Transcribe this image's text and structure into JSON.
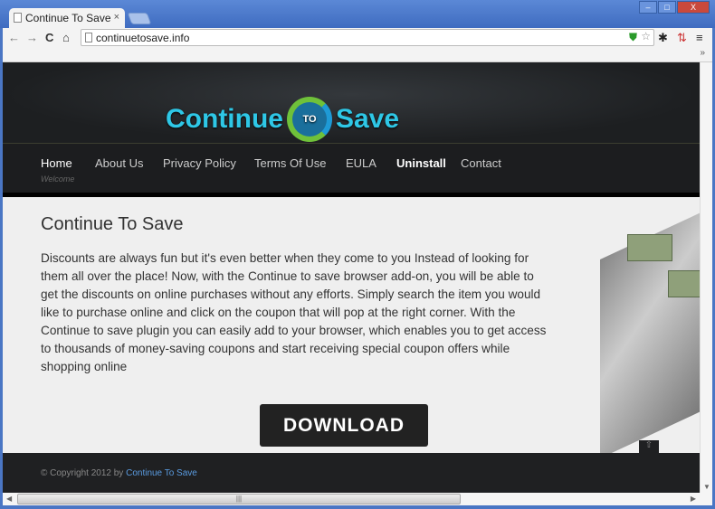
{
  "browser": {
    "tab_title": "Continue To Save",
    "url": "continuetosave.info",
    "win_buttons": [
      "–",
      "□",
      "X"
    ],
    "bookmarks_more": "»"
  },
  "site": {
    "logo": {
      "left": "Continue",
      "middle": "TO",
      "right": "Save"
    },
    "menu": [
      {
        "label": "Home"
      },
      {
        "label": "About Us"
      },
      {
        "label": "Privacy Policy"
      },
      {
        "label": "Terms Of Use"
      },
      {
        "label": "EULA"
      },
      {
        "label": "Uninstall"
      },
      {
        "label": "Contact"
      }
    ],
    "menu_sub": "Welcome",
    "heading": "Continue To Save",
    "paragraph": "Discounts are always fun but it's even better when they come to you Instead of looking for them all over the place! Now, with the Continue to save browser add-on, you will be able to get the discounts on online purchases without any efforts. Simply search the item you would like to purchase online and click on the coupon that will pop at the right corner. With the Continue to save plugin you can easily add to your browser, which enables you to get access to thousands of money-saving coupons and start receiving special coupon offers while shopping online",
    "download": "DOWNLOAD",
    "footer": {
      "copyright": "© Copyright 2012 by",
      "link": "Continue To Save"
    },
    "back_to_top": "⇧"
  },
  "colors": {
    "logo": "#2ec7e6",
    "link": "#5a9be0",
    "header": "#1d1f21"
  }
}
